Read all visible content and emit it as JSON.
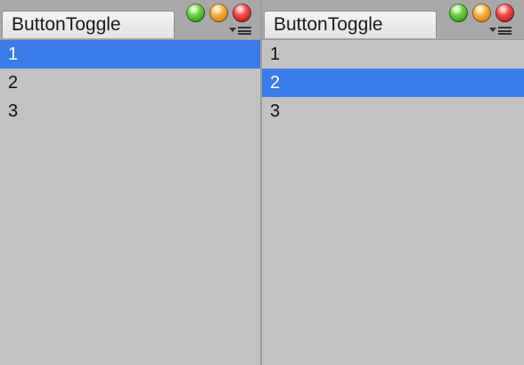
{
  "panels": [
    {
      "tab_title": "ButtonToggle",
      "items": [
        "1",
        "2",
        "3"
      ],
      "selected_index": 0
    },
    {
      "tab_title": "ButtonToggle",
      "items": [
        "1",
        "2",
        "3"
      ],
      "selected_index": 1
    }
  ],
  "icons": {
    "window_buttons": [
      "green-maximize-icon",
      "orange-minimize-icon",
      "red-close-icon"
    ],
    "menu": "panel-menu-icon"
  },
  "colors": {
    "selection": "#3b7be7",
    "content_bg": "#c2c2c2",
    "window_bg": "#a8a8a8"
  }
}
